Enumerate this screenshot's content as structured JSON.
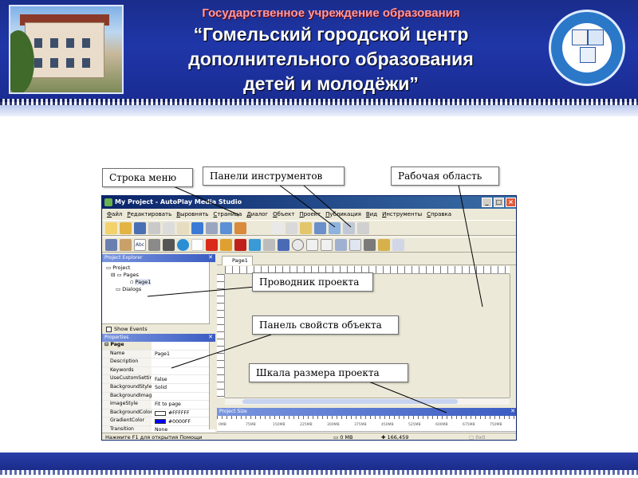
{
  "banner": {
    "line1": "Государственное учреждение образования",
    "line2": "“Гомельский городской центр",
    "line3": "дополнительного образования",
    "line4": "детей и молодёжи”",
    "bg_color": "#1f36a8"
  },
  "app": {
    "title": "My Project - AutoPlay Media Studio",
    "menu": [
      "Файл",
      "Редактировать",
      "Выровнять",
      "Страница",
      "Диалог",
      "Объект",
      "Проект",
      "Публикация",
      "Вид",
      "Инструменты",
      "Справка"
    ],
    "explorer_title": "Project Explorer",
    "tree": [
      "Project",
      "Pages",
      "Page1",
      "Dialogs"
    ],
    "show_events": "Show Events",
    "properties_title": "Properties",
    "prop_group": "Page",
    "props": [
      {
        "k": "Name",
        "v": "Page1"
      },
      {
        "k": "Description",
        "v": ""
      },
      {
        "k": "Keywords",
        "v": ""
      },
      {
        "k": "UseCustomSettin",
        "v": "False"
      },
      {
        "k": "BackgroundStyle",
        "v": "Solid"
      },
      {
        "k": "BackgroundImag",
        "v": ""
      },
      {
        "k": "ImageStyle",
        "v": "Fit to page"
      },
      {
        "k": "BackgroundColor",
        "v": "#FFFFFF",
        "swatch": "#FFFFFF"
      },
      {
        "k": "GradientColor",
        "v": "#0000FF",
        "swatch": "#0000FF"
      },
      {
        "k": "Transition",
        "v": "None"
      }
    ],
    "tab": "Page1",
    "project_size_title": "Project Size",
    "size_ticks": [
      "0MB",
      "75MB",
      "150MB",
      "225MB",
      "300MB",
      "375MB",
      "450MB",
      "525MB",
      "600MB",
      "675MB",
      "750MB"
    ],
    "status": {
      "help": "Нажмите F1 для открытия Помощи",
      "size": "0 MB",
      "coords": "166,459",
      "sel": "0x0"
    }
  },
  "callouts": {
    "menu": "Строка меню",
    "toolbars": "Панели инструментов",
    "workarea": "Рабочая область",
    "explorer": "Проводник проекта",
    "properties": "Панель свойств объекта",
    "size": "Шкала размера проекта"
  }
}
